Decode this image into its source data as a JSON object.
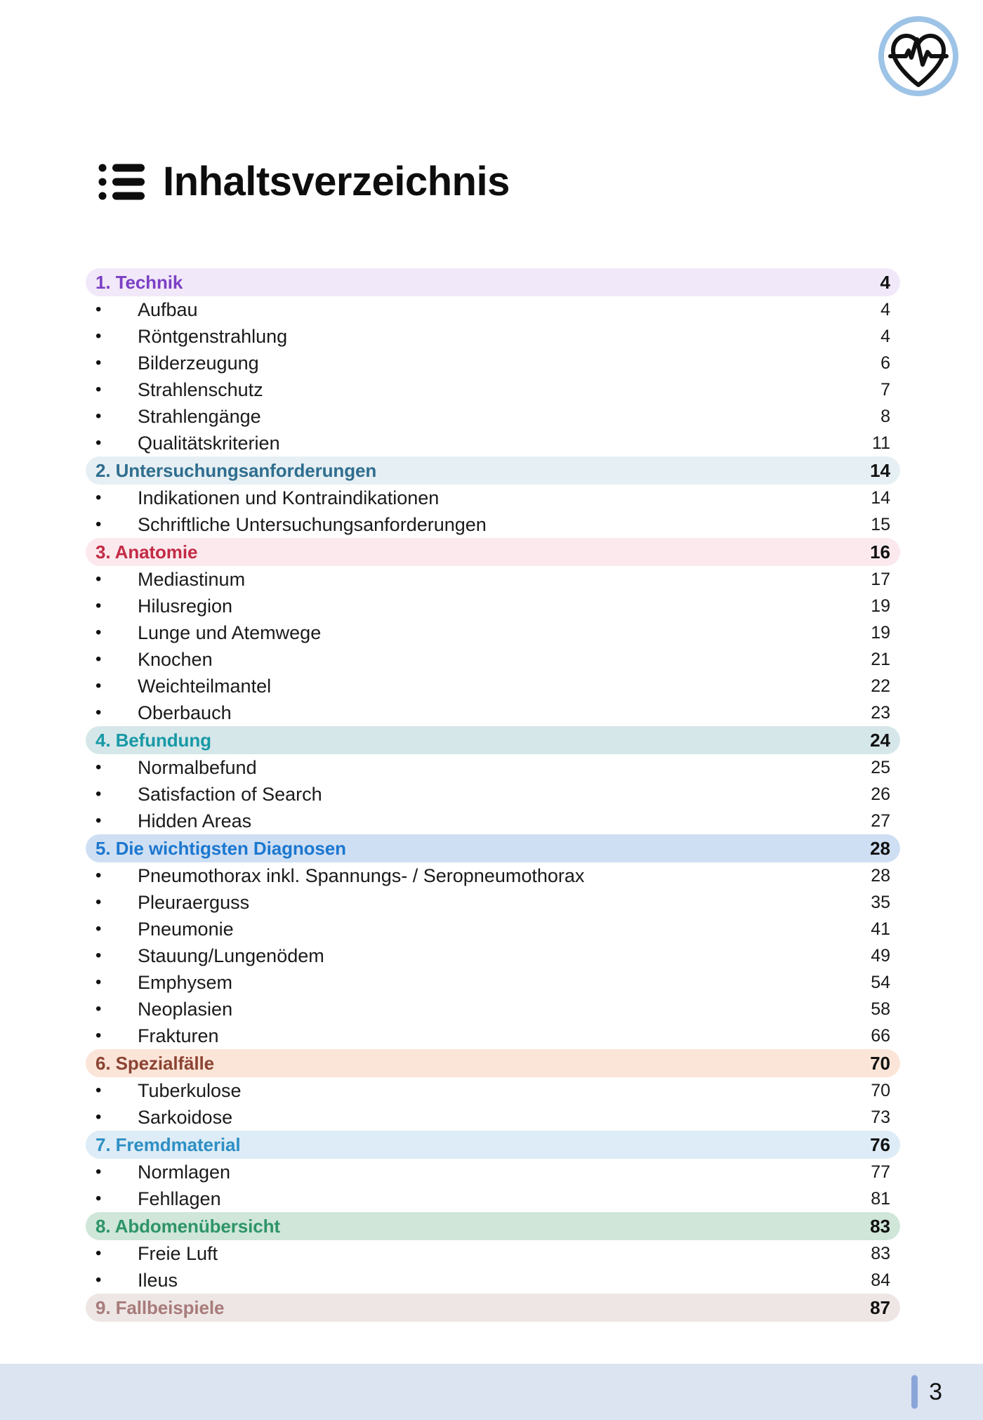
{
  "header": {
    "logo_icon": "heart-pulse-icon",
    "logo_ring_color": "#9DC3E6",
    "logo_glyph_color": "#111111"
  },
  "title": {
    "text": "Inhaltsverzeichnis",
    "icon": "list-bullets-icon"
  },
  "toc": {
    "sections": [
      {
        "number": "1.",
        "label": "1. Technik",
        "page": "4",
        "text_color": "#7B3FC4",
        "bg_color": "#F1E8F9",
        "entries": [
          {
            "label": "Aufbau",
            "page": "4"
          },
          {
            "label": "Röntgenstrahlung",
            "page": "4"
          },
          {
            "label": "Bilderzeugung",
            "page": "6"
          },
          {
            "label": "Strahlenschutz",
            "page": "7"
          },
          {
            "label": "Strahlengänge",
            "page": "8"
          },
          {
            "label": "Qualitätskriterien",
            "page": "11"
          }
        ]
      },
      {
        "number": "2.",
        "label": "2. Untersuchungsanforderungen",
        "page": "14",
        "text_color": "#2F6E8F",
        "bg_color": "#E6EFF3",
        "entries": [
          {
            "label": "Indikationen und Kontraindikationen",
            "page": "14"
          },
          {
            "label": "Schriftliche Untersuchungsanforderungen",
            "page": "15"
          }
        ]
      },
      {
        "number": "3.",
        "label": "3. Anatomie",
        "page": "16",
        "text_color": "#C32B45",
        "bg_color": "#FBE9EE",
        "entries": [
          {
            "label": "Mediastinum",
            "page": "17"
          },
          {
            "label": "Hilusregion",
            "page": "19"
          },
          {
            "label": "Lunge und Atemwege",
            "page": "19"
          },
          {
            "label": "Knochen",
            "page": "21"
          },
          {
            "label": "Weichteilmantel",
            "page": "22"
          },
          {
            "label": "Oberbauch",
            "page": "23"
          }
        ]
      },
      {
        "number": "4.",
        "label": "4. Befundung",
        "page": "24",
        "text_color": "#1799A6",
        "bg_color": "#D6E7E9",
        "entries": [
          {
            "label": "Normalbefund",
            "page": "25"
          },
          {
            "label": "Satisfaction of Search",
            "page": "26"
          },
          {
            "label": "Hidden Areas",
            "page": "27"
          }
        ]
      },
      {
        "number": "5.",
        "label": "5. Die wichtigsten Diagnosen",
        "page": "28",
        "text_color": "#1B77CF",
        "bg_color": "#CFDFF3",
        "entries": [
          {
            "label": "Pneumothorax inkl. Spannungs- / Seropneumothorax",
            "page": "28"
          },
          {
            "label": "Pleuraerguss",
            "page": "35"
          },
          {
            "label": "Pneumonie",
            "page": "41"
          },
          {
            "label": "Stauung/Lungenödem",
            "page": "49"
          },
          {
            "label": "Emphysem",
            "page": "54"
          },
          {
            "label": "Neoplasien",
            "page": "58"
          },
          {
            "label": "Frakturen",
            "page": "66"
          }
        ]
      },
      {
        "number": "6.",
        "label": "6. Spezialfälle",
        "page": "70",
        "text_color": "#8C4433",
        "bg_color": "#FBE5D8",
        "entries": [
          {
            "label": "Tuberkulose",
            "page": "70"
          },
          {
            "label": "Sarkoidose",
            "page": "73"
          }
        ]
      },
      {
        "number": "7.",
        "label": "7. Fremdmaterial",
        "page": "76",
        "text_color": "#2E8FC4",
        "bg_color": "#DDECF6",
        "entries": [
          {
            "label": "Normlagen",
            "page": "77"
          },
          {
            "label": "Fehllagen",
            "page": "81"
          }
        ]
      },
      {
        "number": "8.",
        "label": "8. Abdomenübersicht",
        "page": "83",
        "text_color": "#2E9468",
        "bg_color": "#CFE6D9",
        "entries": [
          {
            "label": "Freie Luft",
            "page": "83"
          },
          {
            "label": "Ileus",
            "page": "84"
          }
        ]
      },
      {
        "number": "9.",
        "label": "9. Fallbeispiele",
        "page": "87",
        "text_color": "#A87B7B",
        "bg_color": "#EDE6E4",
        "entries": []
      }
    ],
    "bullet_glyph": "•"
  },
  "footer": {
    "page_number": "3",
    "band_color": "#DCE4F2",
    "bar_color": "#8AA5D8"
  }
}
